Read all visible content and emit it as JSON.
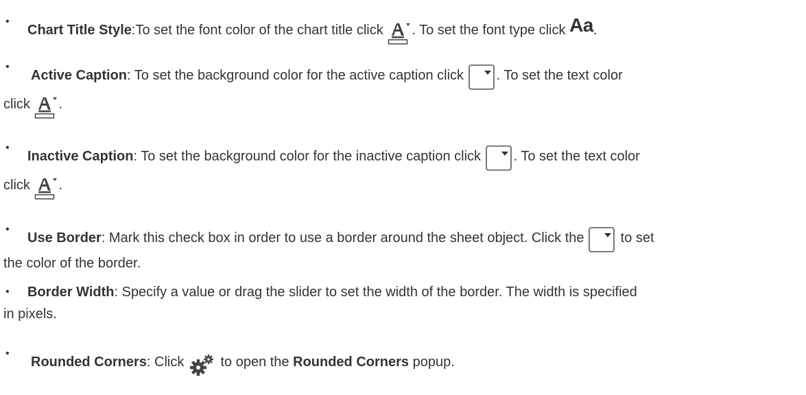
{
  "items": [
    {
      "term": "Chart Title Style",
      "text_1": ":To set the font color of the chart title click ",
      "text_2": ". To set the font type click ",
      "text_3": ".",
      "icons": [
        "font-color-icon",
        "font-type-icon"
      ],
      "font_type_glyph": "Aa"
    },
    {
      "term": "Active Caption",
      "text_1": ": To set the background color for the active caption click ",
      "text_2": ". To set the text color",
      "text_3": "click ",
      "text_4": ".",
      "icons": [
        "color-dropdown-icon",
        "font-color-icon"
      ]
    },
    {
      "term": "Inactive Caption",
      "text_1": ": To set the background color for the inactive caption click ",
      "text_2": ". To set the text color",
      "text_3": "click ",
      "text_4": ".",
      "icons": [
        "color-dropdown-icon",
        "font-color-icon"
      ]
    },
    {
      "term": "Use Border",
      "text_1": ": Mark this check box in order to use a border around the sheet object. Click the ",
      "text_2": " to set",
      "text_3": "the color of the border.",
      "icons": [
        "color-dropdown-icon"
      ]
    },
    {
      "term": "Border Width",
      "text_1": ": Specify a value or drag the slider to set the width of the border. The width is specified",
      "text_2": "in pixels."
    },
    {
      "term": "Rounded Corners",
      "text_1": ": Click ",
      "text_2": " to open the ",
      "term_2": "Rounded Corners",
      "text_3": " popup.",
      "icons": [
        "gear-icon"
      ]
    }
  ],
  "bullet_glyph": "•"
}
